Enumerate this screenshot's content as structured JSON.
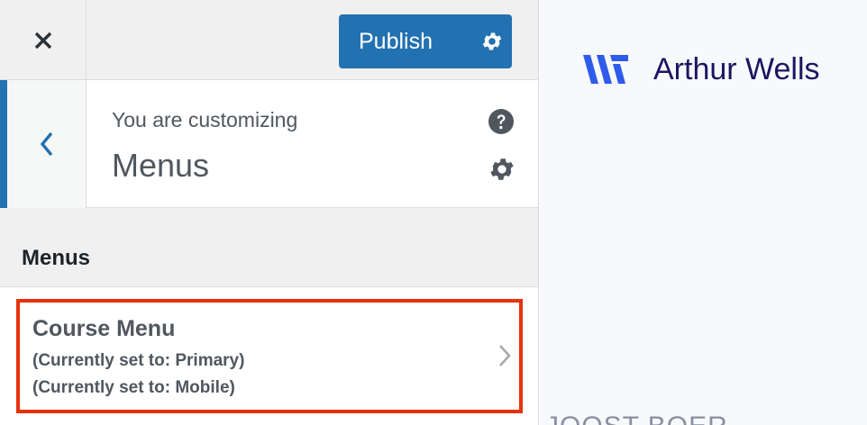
{
  "header": {
    "close_icon": "close-icon",
    "publish_label": "Publish",
    "publish_settings_icon": "gear-icon"
  },
  "context": {
    "back_icon": "chevron-left-icon",
    "subtitle": "You are customizing",
    "title": "Menus",
    "help_icon": "help-icon",
    "settings_icon": "gear-icon"
  },
  "section": {
    "title": "Menus"
  },
  "menus": [
    {
      "title": "Course Menu",
      "locations": [
        "(Currently set to: Primary)",
        "(Currently set to: Mobile)"
      ],
      "icon": "chevron-right-icon",
      "highlighted": true
    }
  ],
  "preview": {
    "site_name": "Arthur Wells",
    "logo_icon": "arthur-wells-logo",
    "clipped_text": "JOOST BOER"
  },
  "colors": {
    "accent": "#2271b1",
    "highlight_border": "#e5330f",
    "brand_logo": "#2f5bea",
    "brand_text": "#1b1560"
  }
}
